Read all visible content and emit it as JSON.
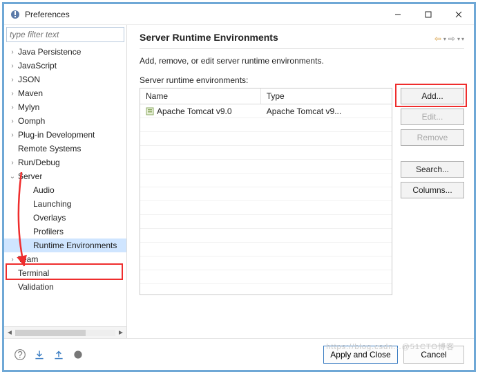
{
  "window": {
    "title": "Preferences",
    "filter_placeholder": "type filter text"
  },
  "tree": {
    "items": [
      {
        "label": "Java Persistence",
        "expandable": true,
        "expanded": false,
        "level": 0
      },
      {
        "label": "JavaScript",
        "expandable": true,
        "expanded": false,
        "level": 0
      },
      {
        "label": "JSON",
        "expandable": true,
        "expanded": false,
        "level": 0
      },
      {
        "label": "Maven",
        "expandable": true,
        "expanded": false,
        "level": 0
      },
      {
        "label": "Mylyn",
        "expandable": true,
        "expanded": false,
        "level": 0
      },
      {
        "label": "Oomph",
        "expandable": true,
        "expanded": false,
        "level": 0
      },
      {
        "label": "Plug-in Development",
        "expandable": true,
        "expanded": false,
        "level": 0
      },
      {
        "label": "Remote Systems",
        "expandable": false,
        "expanded": false,
        "level": 0
      },
      {
        "label": "Run/Debug",
        "expandable": true,
        "expanded": false,
        "level": 0
      },
      {
        "label": "Server",
        "expandable": true,
        "expanded": true,
        "level": 0
      },
      {
        "label": "Audio",
        "expandable": false,
        "expanded": false,
        "level": 1
      },
      {
        "label": "Launching",
        "expandable": false,
        "expanded": false,
        "level": 1
      },
      {
        "label": "Overlays",
        "expandable": false,
        "expanded": false,
        "level": 1
      },
      {
        "label": "Profilers",
        "expandable": false,
        "expanded": false,
        "level": 1
      },
      {
        "label": "Runtime Environments",
        "expandable": false,
        "expanded": false,
        "level": 1,
        "selected": true
      },
      {
        "label": "Team",
        "expandable": true,
        "expanded": false,
        "level": 0
      },
      {
        "label": "Terminal",
        "expandable": false,
        "expanded": false,
        "level": 0
      },
      {
        "label": "Validation",
        "expandable": false,
        "expanded": false,
        "level": 0
      }
    ]
  },
  "main": {
    "heading": "Server Runtime Environments",
    "description": "Add, remove, or edit server runtime environments.",
    "table_label": "Server runtime environments:",
    "columns": {
      "name": "Name",
      "type": "Type"
    },
    "rows": [
      {
        "name": "Apache Tomcat v9.0",
        "type": "Apache Tomcat v9..."
      }
    ],
    "buttons": {
      "add": "Add...",
      "edit": "Edit...",
      "remove": "Remove",
      "search": "Search...",
      "columns": "Columns..."
    }
  },
  "footer": {
    "apply": "Apply and Close",
    "cancel": "Cancel"
  },
  "watermark": "https://blog.csdn...@51CTO博客"
}
